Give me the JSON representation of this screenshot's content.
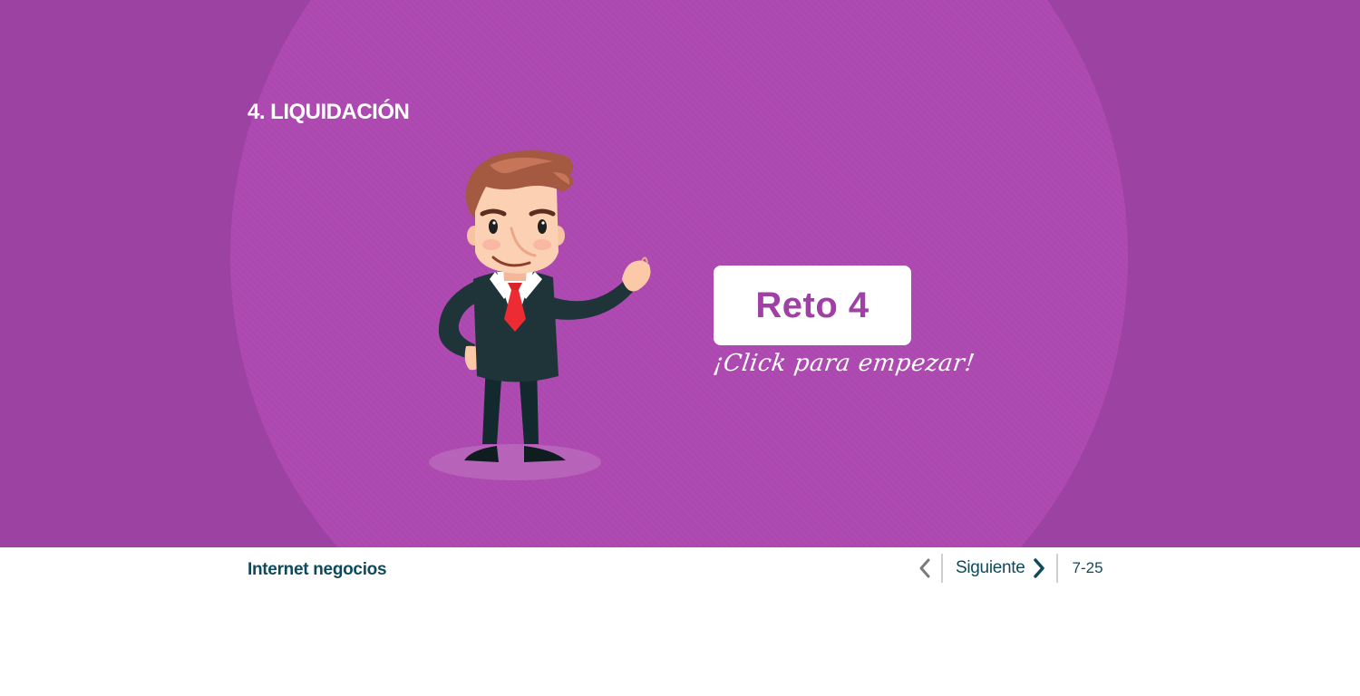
{
  "slide": {
    "section_title": "4. LIQUIDACIÓN",
    "challenge_button_label": "Reto 4",
    "challenge_hint": "¡Click para empezar!",
    "colors": {
      "background": "#9c42a2",
      "spotlight": "#ac48b0",
      "accent_text": "#a03fa6"
    }
  },
  "character": {
    "icon": "businessman-illustration"
  },
  "footer": {
    "brand": "Internet negocios",
    "prev_icon": "chevron-left-icon",
    "next_label": "Siguiente",
    "next_icon": "chevron-right-icon",
    "page_indicator": "7-25",
    "colors": {
      "text": "#0e4a5c",
      "disabled": "#7a7a7a"
    }
  }
}
